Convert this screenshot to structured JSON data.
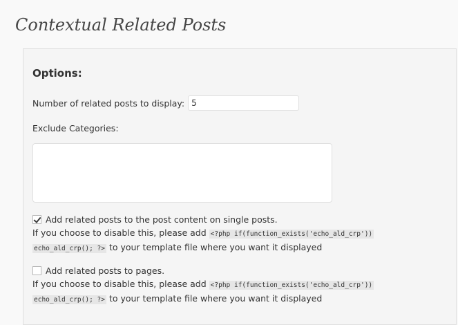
{
  "page": {
    "title": "Contextual Related Posts"
  },
  "options": {
    "heading": "Options:",
    "related_count": {
      "label": "Number of related posts to display:",
      "value": "5"
    },
    "exclude_categories": {
      "label": "Exclude Categories:",
      "value": ""
    },
    "add_to_posts": {
      "checked": true,
      "label": "Add related posts to the post content on single posts.",
      "desc_before": "If you choose to disable this, please add",
      "code_part1": "<?php if(function_exists('echo_ald_crp'))",
      "code_part2": "echo_ald_crp(); ?>",
      "desc_after": "to your template file where you want it displayed"
    },
    "add_to_pages": {
      "checked": false,
      "label": "Add related posts to pages.",
      "desc_before": "If you choose to disable this, please add",
      "code_part1": "<?php if(function_exists('echo_ald_crp'))",
      "code_part2": "echo_ald_crp(); ?>",
      "desc_after": "to your template file where you want it displayed"
    }
  },
  "colors": {
    "background": "#f9f9f9",
    "panel": "#f5f5f5",
    "border": "#dfdfdf",
    "code_bg": "#e6e6e6"
  }
}
